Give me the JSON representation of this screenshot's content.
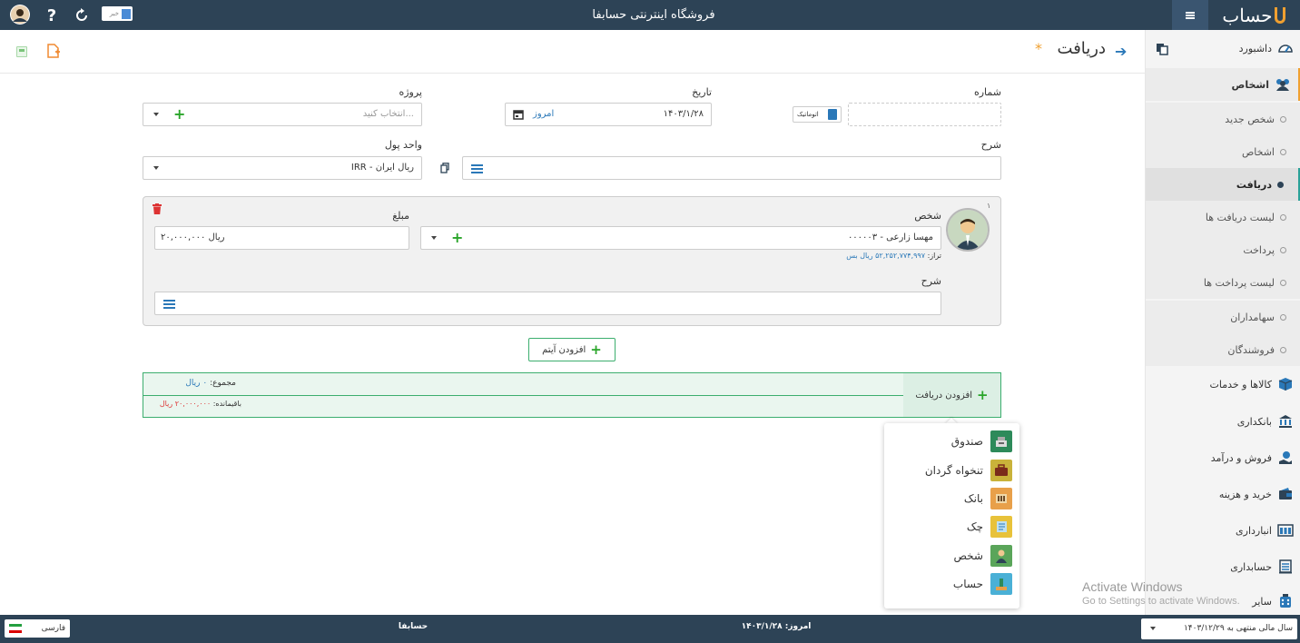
{
  "app": {
    "title": "فروشگاه اینترنتی حسابفا",
    "logo_text": "حساب",
    "news_label": "خبر"
  },
  "page": {
    "title": "دریافت",
    "required_mark": "*"
  },
  "form": {
    "number_label": "شماره",
    "auto_label": "اتوماتیک",
    "date_label": "تاریخ",
    "date_value": "۱۴۰۳/۱/۲۸",
    "today_label": "امروز",
    "project_label": "پروژه",
    "project_placeholder": "انتخاب کنید...",
    "description_label": "شرح",
    "currency_label": "واحد پول",
    "currency_value": "IRR - ریال ایران"
  },
  "item": {
    "index": "۱",
    "person_label": "شخص",
    "person_value": "۰۰۰۰۰۳ - مهسا زارعی",
    "balance_prefix": "تراز:",
    "balance_value": "۵۲,۲۵۲,۷۷۴,۹۹۷ ریال بس",
    "amount_label": "مبلغ",
    "amount_value": "۲۰,۰۰۰,۰۰۰ ریال",
    "description_label": "شرح"
  },
  "add_item_label": "افزودن آیتم",
  "totals": {
    "add_receipt_label": "افزودن دریافت",
    "sum_label": "مجموع:",
    "sum_value": "۰ ریال",
    "remaining_label": "باقیمانده:",
    "remaining_value": "۲۰,۰۰۰,۰۰۰ ریال"
  },
  "dropdown": {
    "items": [
      {
        "label": "صندوق",
        "icon": "cash-register-icon",
        "color": "#2d8a5a"
      },
      {
        "label": "تنخواه گردان",
        "icon": "briefcase-icon",
        "color": "#c9b23a"
      },
      {
        "label": "بانک",
        "icon": "bank-icon",
        "color": "#e8a04a"
      },
      {
        "label": "چک",
        "icon": "cheque-icon",
        "color": "#e8c23a"
      },
      {
        "label": "شخص",
        "icon": "person-icon",
        "color": "#5aa55a"
      },
      {
        "label": "حساب",
        "icon": "account-icon",
        "color": "#4ab0d6"
      }
    ]
  },
  "sidebar": {
    "items": [
      {
        "label": "داشبورد",
        "icon": "dashboard-icon"
      },
      {
        "label": "اشخاص",
        "icon": "people-icon"
      },
      {
        "label": "شخص جدید"
      },
      {
        "label": "اشخاص"
      },
      {
        "label": "دریافت"
      },
      {
        "label": "لیست دریافت ها"
      },
      {
        "label": "پرداخت"
      },
      {
        "label": "لیست پرداخت ها"
      },
      {
        "label": "سهامداران"
      },
      {
        "label": "فروشندگان"
      },
      {
        "label": "کالاها و خدمات",
        "icon": "box-icon"
      },
      {
        "label": "بانکداری",
        "icon": "bank-icon"
      },
      {
        "label": "فروش و درآمد",
        "icon": "sales-icon"
      },
      {
        "label": "خرید و هزینه",
        "icon": "wallet-icon"
      },
      {
        "label": "انبارداری",
        "icon": "warehouse-icon"
      },
      {
        "label": "حسابداری",
        "icon": "ledger-icon"
      },
      {
        "label": "سایر",
        "icon": "other-icon"
      }
    ]
  },
  "watermark": {
    "line1": "Activate Windows",
    "line2": "Go to Settings to activate Windows."
  },
  "footer": {
    "fiscal_year": "سال مالی منتهی به ۱۴۰۳/۱۲/۲۹",
    "today_label": "امروز:",
    "today_value": "۱۴۰۳/۱/۲۸",
    "brand": "حسابفا",
    "language": "فارسی"
  }
}
